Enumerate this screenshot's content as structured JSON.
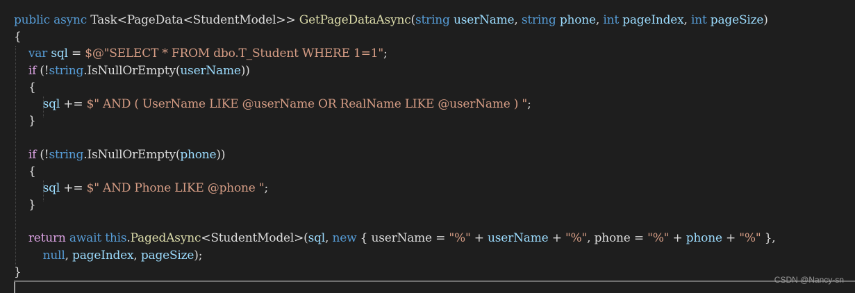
{
  "colors": {
    "background": "#1e1e1e",
    "keyword": "#569cd6",
    "control_keyword": "#d8a0df",
    "type": "#4ec9b0",
    "method": "#dcdcaa",
    "string": "#d69d85",
    "default": "#dcdcdc",
    "parameter": "#9cdcfe",
    "variable": "#9cdcfe"
  },
  "code": {
    "lines": [
      [
        {
          "t": "public",
          "c": "keyword"
        },
        {
          "t": " ",
          "c": "default"
        },
        {
          "t": "async",
          "c": "keyword"
        },
        {
          "t": " Task<PageData<StudentModel>> ",
          "c": "default"
        },
        {
          "t": "GetPageDataAsync",
          "c": "method"
        },
        {
          "t": "(",
          "c": "default"
        },
        {
          "t": "string",
          "c": "keyword"
        },
        {
          "t": " ",
          "c": "default"
        },
        {
          "t": "userName",
          "c": "parameter"
        },
        {
          "t": ", ",
          "c": "default"
        },
        {
          "t": "string",
          "c": "keyword"
        },
        {
          "t": " ",
          "c": "default"
        },
        {
          "t": "phone",
          "c": "parameter"
        },
        {
          "t": ", ",
          "c": "default"
        },
        {
          "t": "int",
          "c": "keyword"
        },
        {
          "t": " ",
          "c": "default"
        },
        {
          "t": "pageIndex",
          "c": "parameter"
        },
        {
          "t": ", ",
          "c": "default"
        },
        {
          "t": "int",
          "c": "keyword"
        },
        {
          "t": " ",
          "c": "default"
        },
        {
          "t": "pageSize",
          "c": "parameter"
        },
        {
          "t": ")",
          "c": "default"
        }
      ],
      [
        {
          "t": "{",
          "c": "default"
        }
      ],
      [
        {
          "t": "    ",
          "c": "default"
        },
        {
          "t": "var",
          "c": "keyword"
        },
        {
          "t": " ",
          "c": "default"
        },
        {
          "t": "sql",
          "c": "variable"
        },
        {
          "t": " = ",
          "c": "default"
        },
        {
          "t": "$@\"SELECT * FROM dbo.T_Student WHERE 1=1\"",
          "c": "string"
        },
        {
          "t": ";",
          "c": "default"
        }
      ],
      [
        {
          "t": "    ",
          "c": "default"
        },
        {
          "t": "if",
          "c": "control_keyword"
        },
        {
          "t": " (!",
          "c": "default"
        },
        {
          "t": "string",
          "c": "keyword"
        },
        {
          "t": ".IsNullOrEmpty(",
          "c": "default"
        },
        {
          "t": "userName",
          "c": "parameter"
        },
        {
          "t": "))",
          "c": "default"
        }
      ],
      [
        {
          "t": "    {",
          "c": "default"
        }
      ],
      [
        {
          "t": "        ",
          "c": "default"
        },
        {
          "t": "sql",
          "c": "variable"
        },
        {
          "t": " += ",
          "c": "default"
        },
        {
          "t": "$\" AND ( UserName LIKE @userName OR RealName LIKE @userName ) \"",
          "c": "string"
        },
        {
          "t": ";",
          "c": "default"
        }
      ],
      [
        {
          "t": "    }",
          "c": "default"
        }
      ],
      [
        {
          "t": "",
          "c": "default"
        }
      ],
      [
        {
          "t": "    ",
          "c": "default"
        },
        {
          "t": "if",
          "c": "control_keyword"
        },
        {
          "t": " (!",
          "c": "default"
        },
        {
          "t": "string",
          "c": "keyword"
        },
        {
          "t": ".IsNullOrEmpty(",
          "c": "default"
        },
        {
          "t": "phone",
          "c": "parameter"
        },
        {
          "t": "))",
          "c": "default"
        }
      ],
      [
        {
          "t": "    {",
          "c": "default"
        }
      ],
      [
        {
          "t": "        ",
          "c": "default"
        },
        {
          "t": "sql",
          "c": "variable"
        },
        {
          "t": " += ",
          "c": "default"
        },
        {
          "t": "$\" AND Phone LIKE @phone \"",
          "c": "string"
        },
        {
          "t": ";",
          "c": "default"
        }
      ],
      [
        {
          "t": "    }",
          "c": "default"
        }
      ],
      [
        {
          "t": "",
          "c": "default"
        }
      ],
      [
        {
          "t": "    ",
          "c": "default"
        },
        {
          "t": "return",
          "c": "control_keyword"
        },
        {
          "t": " ",
          "c": "default"
        },
        {
          "t": "await",
          "c": "keyword"
        },
        {
          "t": " ",
          "c": "default"
        },
        {
          "t": "this",
          "c": "keyword"
        },
        {
          "t": ".",
          "c": "default"
        },
        {
          "t": "PagedAsync",
          "c": "method"
        },
        {
          "t": "<StudentModel>(",
          "c": "default"
        },
        {
          "t": "sql",
          "c": "variable"
        },
        {
          "t": ", ",
          "c": "default"
        },
        {
          "t": "new",
          "c": "keyword"
        },
        {
          "t": " { ",
          "c": "default"
        },
        {
          "t": "userName",
          "c": "default"
        },
        {
          "t": " = ",
          "c": "default"
        },
        {
          "t": "\"%\"",
          "c": "string"
        },
        {
          "t": " + ",
          "c": "default"
        },
        {
          "t": "userName",
          "c": "parameter"
        },
        {
          "t": " + ",
          "c": "default"
        },
        {
          "t": "\"%\"",
          "c": "string"
        },
        {
          "t": ", ",
          "c": "default"
        },
        {
          "t": "phone",
          "c": "default"
        },
        {
          "t": " = ",
          "c": "default"
        },
        {
          "t": "\"%\"",
          "c": "string"
        },
        {
          "t": " + ",
          "c": "default"
        },
        {
          "t": "phone",
          "c": "parameter"
        },
        {
          "t": " + ",
          "c": "default"
        },
        {
          "t": "\"%\"",
          "c": "string"
        },
        {
          "t": " },",
          "c": "default"
        }
      ],
      [
        {
          "t": "        ",
          "c": "default"
        },
        {
          "t": "null",
          "c": "keyword"
        },
        {
          "t": ", ",
          "c": "default"
        },
        {
          "t": "pageIndex",
          "c": "parameter"
        },
        {
          "t": ", ",
          "c": "default"
        },
        {
          "t": "pageSize",
          "c": "parameter"
        },
        {
          "t": ");",
          "c": "default"
        }
      ],
      [
        {
          "t": "}",
          "c": "default"
        }
      ]
    ]
  },
  "watermark": "CSDN @Nancy-sn"
}
